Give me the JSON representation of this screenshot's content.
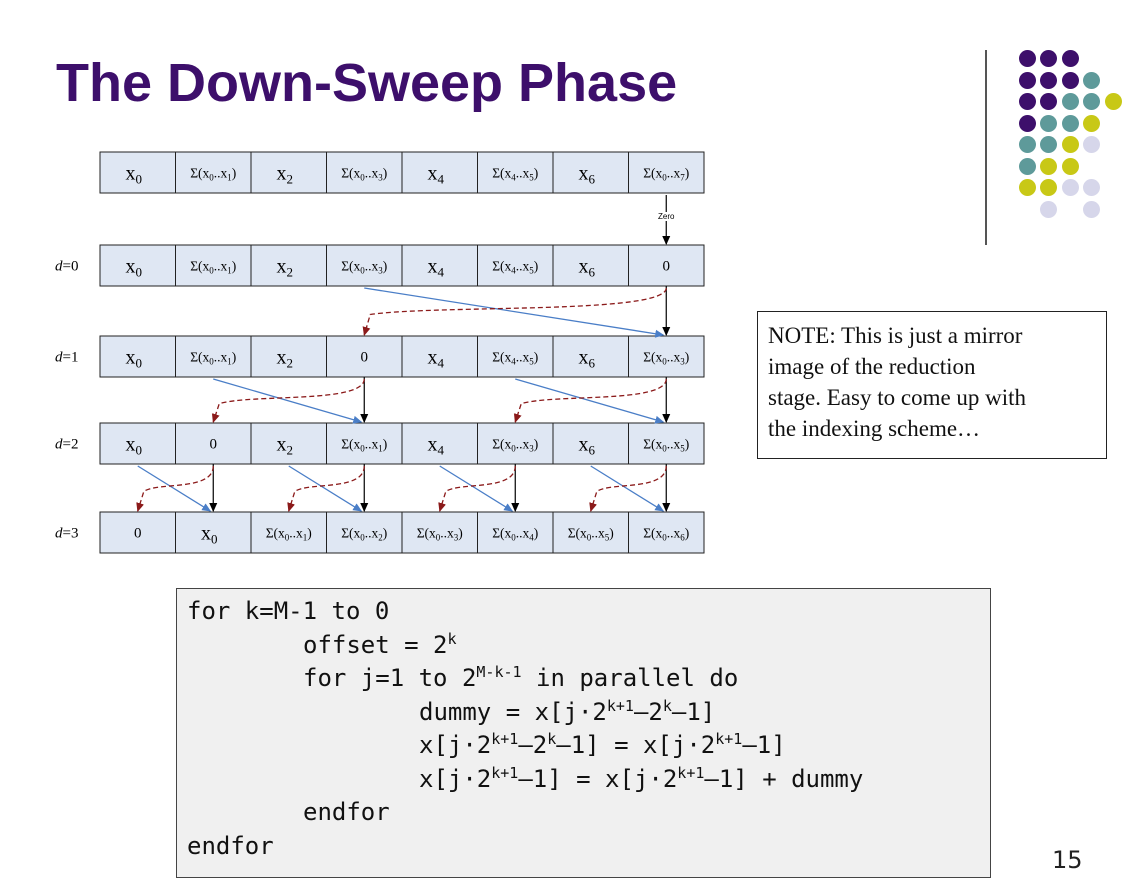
{
  "slide": {
    "title": "The Down-Sweep Phase",
    "page_number": "15",
    "colors": {
      "title": "#3d0f6b",
      "cell_fill": "#dfe7f3",
      "dark_arrow": "#8b1a1a",
      "blue_arrow": "#4a7ec7"
    }
  },
  "decoration": {
    "icon": "dot-grid-icon",
    "dot_colors": {
      "purple": "#3d0f6b",
      "teal": "#5e9a9a",
      "yellow": "#c8c816",
      "lavender": "#d6d6ea"
    }
  },
  "diagram": {
    "zero_label": "Zero",
    "rows": [
      {
        "label": "",
        "cells": [
          {
            "base": "x",
            "sub": "0",
            "type": "x"
          },
          {
            "type": "sum",
            "a": "0",
            "b": "1"
          },
          {
            "base": "x",
            "sub": "2",
            "type": "x"
          },
          {
            "type": "sum",
            "a": "0",
            "b": "3"
          },
          {
            "base": "x",
            "sub": "4",
            "type": "x"
          },
          {
            "type": "sum",
            "a": "4",
            "b": "5"
          },
          {
            "base": "x",
            "sub": "6",
            "type": "x"
          },
          {
            "type": "sum",
            "a": "0",
            "b": "7"
          }
        ]
      },
      {
        "label": "d=0",
        "label_var": "d",
        "label_val": "=0",
        "cells": [
          {
            "base": "x",
            "sub": "0",
            "type": "x"
          },
          {
            "type": "sum",
            "a": "0",
            "b": "1"
          },
          {
            "base": "x",
            "sub": "2",
            "type": "x"
          },
          {
            "type": "sum",
            "a": "0",
            "b": "3"
          },
          {
            "base": "x",
            "sub": "4",
            "type": "x"
          },
          {
            "type": "sum",
            "a": "4",
            "b": "5"
          },
          {
            "base": "x",
            "sub": "6",
            "type": "x"
          },
          {
            "type": "plain",
            "text": "0"
          }
        ]
      },
      {
        "label": "d=1",
        "label_var": "d",
        "label_val": "=1",
        "cells": [
          {
            "base": "x",
            "sub": "0",
            "type": "x"
          },
          {
            "type": "sum",
            "a": "0",
            "b": "1"
          },
          {
            "base": "x",
            "sub": "2",
            "type": "x"
          },
          {
            "type": "plain",
            "text": "0"
          },
          {
            "base": "x",
            "sub": "4",
            "type": "x"
          },
          {
            "type": "sum",
            "a": "4",
            "b": "5"
          },
          {
            "base": "x",
            "sub": "6",
            "type": "x"
          },
          {
            "type": "sum",
            "a": "0",
            "b": "3"
          }
        ]
      },
      {
        "label": "d=2",
        "label_var": "d",
        "label_val": "=2",
        "cells": [
          {
            "base": "x",
            "sub": "0",
            "type": "x"
          },
          {
            "type": "plain",
            "text": "0"
          },
          {
            "base": "x",
            "sub": "2",
            "type": "x"
          },
          {
            "type": "sum",
            "a": "0",
            "b": "1"
          },
          {
            "base": "x",
            "sub": "4",
            "type": "x"
          },
          {
            "type": "sum",
            "a": "0",
            "b": "3"
          },
          {
            "base": "x",
            "sub": "6",
            "type": "x"
          },
          {
            "type": "sum",
            "a": "0",
            "b": "5"
          }
        ]
      },
      {
        "label": "d=3",
        "label_var": "d",
        "label_val": "=3",
        "cells": [
          {
            "type": "plain",
            "text": "0"
          },
          {
            "base": "x",
            "sub": "0",
            "type": "x"
          },
          {
            "type": "sum",
            "a": "0",
            "b": "1"
          },
          {
            "type": "sum",
            "a": "0",
            "b": "2"
          },
          {
            "type": "sum",
            "a": "0",
            "b": "3"
          },
          {
            "type": "sum",
            "a": "0",
            "b": "4"
          },
          {
            "type": "sum",
            "a": "0",
            "b": "5"
          },
          {
            "type": "sum",
            "a": "0",
            "b": "6"
          }
        ]
      }
    ],
    "transitions": [
      {
        "from_row": 1,
        "pairs": [
          [
            3,
            7
          ]
        ]
      },
      {
        "from_row": 2,
        "pairs": [
          [
            1,
            3
          ],
          [
            5,
            7
          ]
        ]
      },
      {
        "from_row": 3,
        "pairs": [
          [
            0,
            1
          ],
          [
            2,
            3
          ],
          [
            4,
            5
          ],
          [
            6,
            7
          ]
        ]
      }
    ]
  },
  "note": {
    "lines": [
      "NOTE: This is just a mirror",
      "image of the reduction",
      "stage. Easy to come up with",
      "the indexing scheme…"
    ]
  },
  "code": {
    "lines": [
      {
        "indent": 0,
        "parts": [
          {
            "t": "for k=M-1 to 0"
          }
        ]
      },
      {
        "indent": 1,
        "parts": [
          {
            "t": "offset = 2"
          },
          {
            "sup": "k"
          }
        ]
      },
      {
        "indent": 1,
        "parts": [
          {
            "t": "for j=1 to 2"
          },
          {
            "sup": "M-k-1"
          },
          {
            "t": " in parallel do"
          }
        ]
      },
      {
        "indent": 2,
        "parts": [
          {
            "t": "dummy = x[j·2"
          },
          {
            "sup": "k+1"
          },
          {
            "t": "–2"
          },
          {
            "sup": "k"
          },
          {
            "t": "–1]"
          }
        ]
      },
      {
        "indent": 2,
        "parts": [
          {
            "t": "x[j·2"
          },
          {
            "sup": "k+1"
          },
          {
            "t": "–2"
          },
          {
            "sup": "k"
          },
          {
            "t": "–1] = x[j·2"
          },
          {
            "sup": "k+1"
          },
          {
            "t": "–1]"
          }
        ]
      },
      {
        "indent": 2,
        "parts": [
          {
            "t": "x[j·2"
          },
          {
            "sup": "k+1"
          },
          {
            "t": "–1] = x[j·2"
          },
          {
            "sup": "k+1"
          },
          {
            "t": "–1] + dummy"
          }
        ]
      },
      {
        "indent": 1,
        "parts": [
          {
            "t": "endfor"
          }
        ]
      },
      {
        "indent": 0,
        "parts": [
          {
            "t": "endfor"
          }
        ]
      }
    ]
  }
}
